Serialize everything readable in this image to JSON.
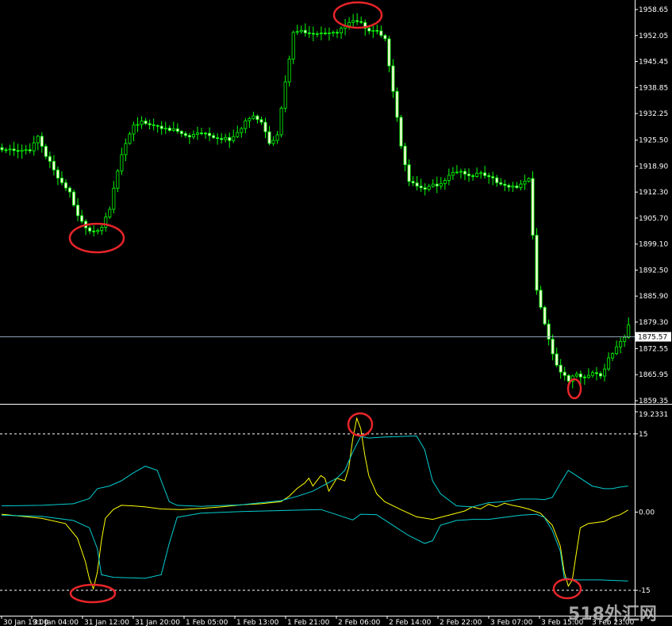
{
  "chart_data": [
    {
      "type": "candlestick",
      "panel": "price",
      "price_axis": {
        "ticks": [
          "1958.65",
          "1952.05",
          "1945.45",
          "1938.85",
          "1932.25",
          "1925.50",
          "1918.90",
          "1912.30",
          "1905.70",
          "1899.10",
          "1892.50",
          "1885.90",
          "1879.30",
          "1872.55",
          "1865.95",
          "1859.35"
        ],
        "ylim": [
          1859.35,
          1958.65
        ]
      },
      "current_price": "1875.57",
      "close_path": [
        [
          0,
          1923.3
        ],
        [
          3,
          1922.6
        ],
        [
          7,
          1923.0
        ],
        [
          9,
          1926.5
        ],
        [
          11,
          1921.5
        ],
        [
          13,
          1918.0
        ],
        [
          15,
          1914.5
        ],
        [
          17,
          1912.5
        ],
        [
          19,
          1906.0
        ],
        [
          21,
          1903.0
        ],
        [
          23,
          1902.0
        ],
        [
          25,
          1903.5
        ],
        [
          27,
          1908.0
        ],
        [
          29,
          1918.0
        ],
        [
          31,
          1925.0
        ],
        [
          33,
          1929.0
        ],
        [
          35,
          1930.0
        ],
        [
          37,
          1929.5
        ],
        [
          39,
          1929.0
        ],
        [
          41,
          1928.5
        ],
        [
          43,
          1928.0
        ],
        [
          45,
          1927.0
        ],
        [
          47,
          1926.5
        ],
        [
          49,
          1927.0
        ],
        [
          51,
          1927.5
        ],
        [
          53,
          1926.5
        ],
        [
          55,
          1926.0
        ],
        [
          57,
          1925.5
        ],
        [
          59,
          1927.5
        ],
        [
          61,
          1930.0
        ],
        [
          63,
          1931.5
        ],
        [
          65,
          1930.0
        ],
        [
          67,
          1924.5
        ],
        [
          69,
          1926.5
        ],
        [
          71,
          1940.0
        ],
        [
          73,
          1952.5
        ],
        [
          75,
          1953.0
        ],
        [
          78,
          1952.5
        ],
        [
          81,
          1952.5
        ],
        [
          84,
          1953.0
        ],
        [
          86,
          1954.5
        ],
        [
          88,
          1955.5
        ],
        [
          90,
          1955.0
        ],
        [
          92,
          1953.5
        ],
        [
          94,
          1953.0
        ],
        [
          96,
          1951.0
        ],
        [
          98,
          1938.0
        ],
        [
          100,
          1924.0
        ],
        [
          102,
          1915.0
        ],
        [
          104,
          1913.5
        ],
        [
          106,
          1913.0
        ],
        [
          108,
          1914.0
        ],
        [
          110,
          1914.5
        ],
        [
          112,
          1916.5
        ],
        [
          114,
          1917.5
        ],
        [
          116,
          1917.0
        ],
        [
          118,
          1916.5
        ],
        [
          120,
          1917.0
        ],
        [
          122,
          1916.5
        ],
        [
          124,
          1915.0
        ],
        [
          126,
          1914.0
        ],
        [
          128,
          1913.5
        ],
        [
          130,
          1914.0
        ],
        [
          132,
          1916.0
        ],
        [
          134,
          1887.0
        ],
        [
          136,
          1879.0
        ],
        [
          138,
          1871.0
        ],
        [
          140,
          1866.5
        ],
        [
          142,
          1864.5
        ],
        [
          144,
          1866.0
        ],
        [
          146,
          1865.5
        ],
        [
          148,
          1866.5
        ],
        [
          150,
          1865.5
        ],
        [
          152,
          1870.0
        ],
        [
          154,
          1873.0
        ],
        [
          156,
          1875.5
        ],
        [
          157,
          1878.5
        ]
      ]
    },
    {
      "type": "line",
      "panel": "oscillator",
      "y_axis": {
        "ticks": [
          "19.2331",
          "15",
          "0.00",
          "-15"
        ],
        "ylim": [
          -15.6,
          19.2331
        ]
      },
      "levels": [
        15,
        -15
      ],
      "series": [
        {
          "color": "#ffff00",
          "values": [
            [
              0,
              -0.4
            ],
            [
              10,
              -1.2
            ],
            [
              16,
              -2.2
            ],
            [
              19,
              -5.0
            ],
            [
              21,
              -9.5
            ],
            [
              22,
              -12.8
            ],
            [
              23,
              -14.7
            ],
            [
              24,
              -11.5
            ],
            [
              25,
              -5.5
            ],
            [
              26,
              -1.2
            ],
            [
              28,
              0.5
            ],
            [
              30,
              1.3
            ],
            [
              33,
              1.2
            ],
            [
              36,
              1.0
            ],
            [
              40,
              0.6
            ],
            [
              45,
              0.5
            ],
            [
              50,
              0.7
            ],
            [
              55,
              1.0
            ],
            [
              60,
              1.4
            ],
            [
              65,
              1.6
            ],
            [
              70,
              2.0
            ],
            [
              72,
              3.0
            ],
            [
              74,
              4.5
            ],
            [
              76,
              5.6
            ],
            [
              77,
              6.5
            ],
            [
              78,
              5.0
            ],
            [
              80,
              7.0
            ],
            [
              81,
              6.5
            ],
            [
              82,
              4.0
            ],
            [
              84,
              6.5
            ],
            [
              86,
              6.0
            ],
            [
              87,
              8.5
            ],
            [
              88,
              14.0
            ],
            [
              89,
              18.0
            ],
            [
              90,
              16.0
            ],
            [
              91,
              11.0
            ],
            [
              92,
              7.0
            ],
            [
              94,
              3.5
            ],
            [
              96,
              2.0
            ],
            [
              100,
              0.5
            ],
            [
              104,
              -0.9
            ],
            [
              108,
              -1.4
            ],
            [
              112,
              -0.6
            ],
            [
              116,
              0.2
            ],
            [
              118,
              1.0
            ],
            [
              120,
              0.6
            ],
            [
              122,
              1.5
            ],
            [
              124,
              1.0
            ],
            [
              126,
              1.7
            ],
            [
              128,
              1.3
            ],
            [
              130,
              1.0
            ],
            [
              132,
              0.6
            ],
            [
              135,
              -0.2
            ],
            [
              138,
              -2.5
            ],
            [
              140,
              -6.5
            ],
            [
              141,
              -11.5
            ],
            [
              142,
              -14.2
            ],
            [
              143,
              -13.0
            ],
            [
              144,
              -8.0
            ],
            [
              145,
              -3.0
            ],
            [
              147,
              -2.2
            ],
            [
              149,
              -2.0
            ],
            [
              151,
              -1.8
            ],
            [
              153,
              -1.0
            ],
            [
              155,
              -0.5
            ],
            [
              157,
              0.4
            ]
          ]
        },
        {
          "color": "#00ced1",
          "values": [
            [
              0,
              1.2
            ],
            [
              10,
              1.3
            ],
            [
              18,
              1.6
            ],
            [
              22,
              2.6
            ],
            [
              24,
              4.5
            ],
            [
              27,
              5.0
            ],
            [
              30,
              6.0
            ],
            [
              33,
              7.5
            ],
            [
              36,
              8.8
            ],
            [
              39,
              8.0
            ],
            [
              42,
              2.0
            ],
            [
              44,
              1.3
            ],
            [
              50,
              1.1
            ],
            [
              60,
              1.4
            ],
            [
              70,
              2.2
            ],
            [
              74,
              3.0
            ],
            [
              78,
              4.0
            ],
            [
              84,
              6.5
            ],
            [
              86,
              8.0
            ],
            [
              88,
              11.5
            ],
            [
              90,
              14.5
            ],
            [
              92,
              14.2
            ],
            [
              96,
              14.4
            ],
            [
              100,
              14.5
            ],
            [
              104,
              14.6
            ],
            [
              106,
              12.0
            ],
            [
              108,
              6.0
            ],
            [
              110,
              3.5
            ],
            [
              114,
              1.2
            ],
            [
              118,
              1.0
            ],
            [
              122,
              1.8
            ],
            [
              126,
              2.0
            ],
            [
              130,
              2.5
            ],
            [
              134,
              2.5
            ],
            [
              136,
              2.4
            ],
            [
              138,
              2.8
            ],
            [
              140,
              5.5
            ],
            [
              142,
              8.0
            ],
            [
              145,
              6.5
            ],
            [
              148,
              5.0
            ],
            [
              151,
              4.5
            ],
            [
              153,
              4.5
            ],
            [
              155,
              4.8
            ],
            [
              157,
              5.0
            ]
          ]
        },
        {
          "color": "#00ced1",
          "values": [
            [
              0,
              -0.6
            ],
            [
              10,
              -0.8
            ],
            [
              18,
              -1.6
            ],
            [
              22,
              -3.0
            ],
            [
              24,
              -7.0
            ],
            [
              25,
              -12.0
            ],
            [
              28,
              -12.5
            ],
            [
              32,
              -12.6
            ],
            [
              36,
              -12.7
            ],
            [
              40,
              -12.0
            ],
            [
              42,
              -6.0
            ],
            [
              44,
              -1.0
            ],
            [
              50,
              -0.2
            ],
            [
              60,
              0.1
            ],
            [
              70,
              0.3
            ],
            [
              80,
              0.5
            ],
            [
              84,
              -0.5
            ],
            [
              88,
              -1.5
            ],
            [
              90,
              -0.4
            ],
            [
              94,
              -0.5
            ],
            [
              98,
              -2.5
            ],
            [
              102,
              -4.5
            ],
            [
              106,
              -6.0
            ],
            [
              108,
              -5.5
            ],
            [
              110,
              -2.5
            ],
            [
              114,
              -1.6
            ],
            [
              118,
              -1.4
            ],
            [
              122,
              -1.4
            ],
            [
              126,
              -1.0
            ],
            [
              130,
              -0.6
            ],
            [
              134,
              -0.4
            ],
            [
              136,
              -1.0
            ],
            [
              138,
              -3.5
            ],
            [
              140,
              -7.5
            ],
            [
              141,
              -12.6
            ],
            [
              144,
              -13.0
            ],
            [
              150,
              -13.0
            ],
            [
              157,
              -13.2
            ]
          ]
        }
      ]
    }
  ],
  "time_axis": [
    "30 Jan 19:00",
    "31 Jan 04:00",
    "31 Jan 12:00",
    "31 Jan 20:00",
    "1 Feb 05:00",
    "1 Feb 13:00",
    "1 Feb 21:00",
    "2 Feb 06:00",
    "2 Feb 14:00",
    "2 Feb 22:00",
    "3 Feb 07:00",
    "3 Feb 15:00",
    "3 Feb 23:00"
  ],
  "watermark": "518外汇网",
  "colors": {
    "background": "#000000",
    "bull": "#00ff00",
    "bull_body": "#ffffe0",
    "osc_main": "#ffff00",
    "osc_band": "#00ced1",
    "circle": "#e8252a",
    "price_line": "#8ea4b8",
    "axis_text": "#ffffff"
  }
}
